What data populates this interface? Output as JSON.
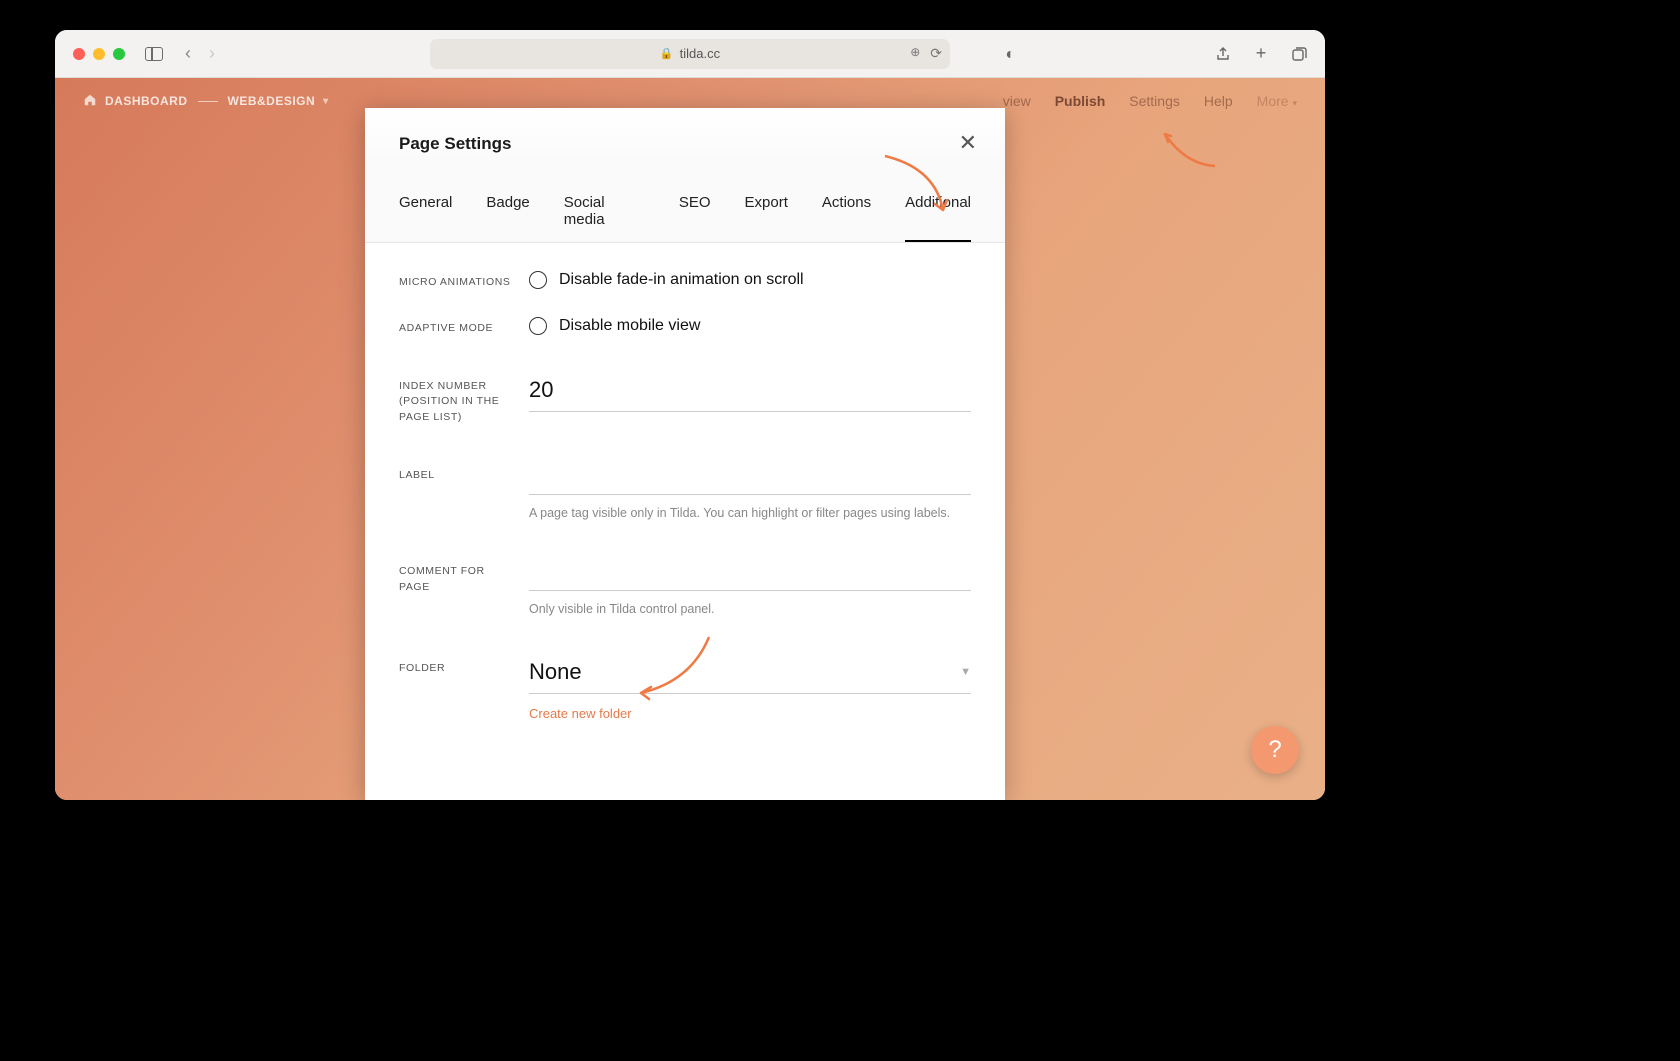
{
  "browser": {
    "url_host": "tilda.cc"
  },
  "header": {
    "breadcrumb_root": "DASHBOARD",
    "breadcrumb_current": "WEB&DESIGN",
    "nav": {
      "preview": "view",
      "publish": "Publish",
      "settings": "Settings",
      "help": "Help",
      "more": "More"
    }
  },
  "modal": {
    "title": "Page Settings",
    "tabs": {
      "general": "General",
      "badge": "Badge",
      "social": "Social media",
      "seo": "SEO",
      "export": "Export",
      "actions": "Actions",
      "additional": "Additional"
    },
    "fields": {
      "micro_label": "MICRO ANIMATIONS",
      "micro_option": "Disable fade-in animation on scroll",
      "adaptive_label": "ADAPTIVE MODE",
      "adaptive_option": "Disable mobile view",
      "index_label": "INDEX NUMBER (POSITION IN THE PAGE LIST)",
      "index_value": "20",
      "label_label": "LABEL",
      "label_value": "",
      "label_help": "A page tag visible only in Tilda. You can highlight or filter pages using labels.",
      "comment_label": "COMMENT FOR PAGE",
      "comment_value": "",
      "comment_help": "Only visible in Tilda control panel.",
      "folder_label": "FOLDER",
      "folder_value": "None",
      "folder_create": "Create new folder"
    }
  },
  "fab": {
    "label": "?"
  }
}
